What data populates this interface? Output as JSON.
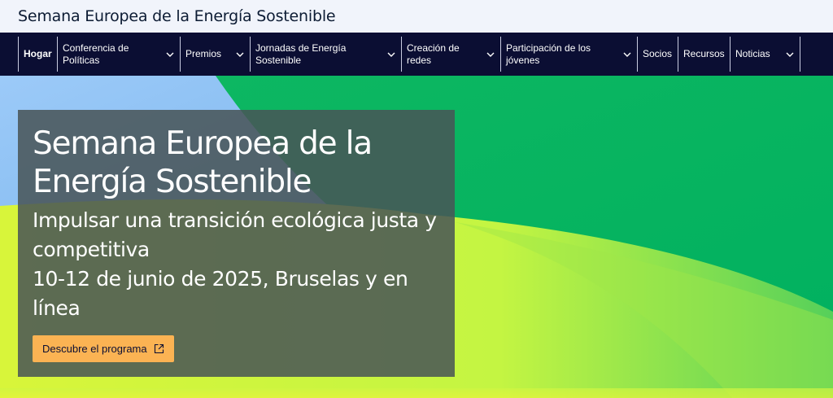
{
  "header": {
    "site_title": "Semana Europea de la Energía Sostenible"
  },
  "nav": {
    "items": [
      {
        "label": "Hogar",
        "has_dropdown": false,
        "active": true
      },
      {
        "label": "Conferencia de Políticas",
        "has_dropdown": true
      },
      {
        "label": "Premios",
        "has_dropdown": true
      },
      {
        "label": "Jornadas de Energía Sostenible",
        "has_dropdown": true
      },
      {
        "label": "Creación de redes",
        "has_dropdown": true
      },
      {
        "label": "Participación de los jóvenes",
        "has_dropdown": true
      },
      {
        "label": "Socios",
        "has_dropdown": false
      },
      {
        "label": "Recursos",
        "has_dropdown": false
      },
      {
        "label": "Noticias",
        "has_dropdown": true
      }
    ]
  },
  "hero": {
    "title": "Semana Europea de la Energía Sostenible",
    "subtitle": "Impulsar una transición ecológica justa y competitiva",
    "dates": "10-12 de junio de 2025, Bruselas y en línea",
    "cta_label": "Descubre el programa",
    "cta_icon": "external-link-icon"
  },
  "colors": {
    "header_bg": "#f1f4fb",
    "nav_bg": "#0b0e33",
    "hero_green": "#00b15e",
    "hero_lime": "#d8f53a",
    "hero_sky": "#8ec5f6",
    "overlay": "#485456",
    "cta_bg": "#fbb353"
  }
}
